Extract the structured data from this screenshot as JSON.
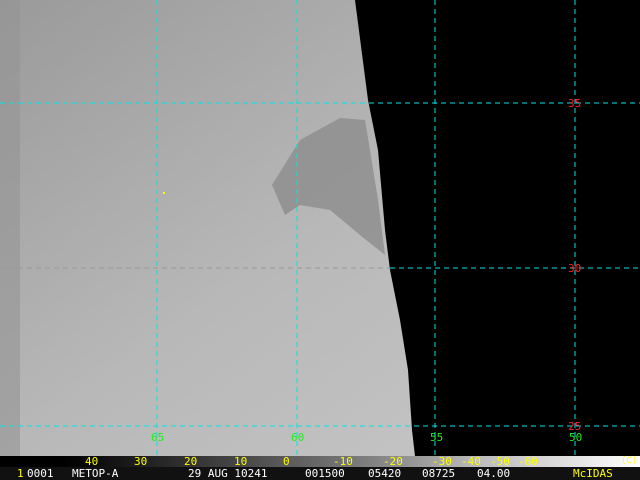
{
  "colors": {
    "grid": "#00e5e5",
    "lat_label": "#ff2020",
    "lon_label": "#22ee22",
    "scale_label": "#ffff00",
    "text": "#ffffff"
  },
  "latitudes": [
    "35",
    "30",
    "25"
  ],
  "longitudes": [
    "65",
    "60",
    "55",
    "50"
  ],
  "scale_ticks": [
    "40",
    "30",
    "20",
    "10",
    "0",
    "-10",
    "-20",
    "-30",
    "-40",
    "-50",
    "-60"
  ],
  "copyright": "(C)",
  "info": {
    "frame": "1",
    "image_no": "0001",
    "satellite": "METOP-A",
    "date": "29 AUG 10241",
    "time": "001500",
    "line": "05420",
    "element": "08725",
    "res": "04.00",
    "brand": "McIDAS"
  }
}
